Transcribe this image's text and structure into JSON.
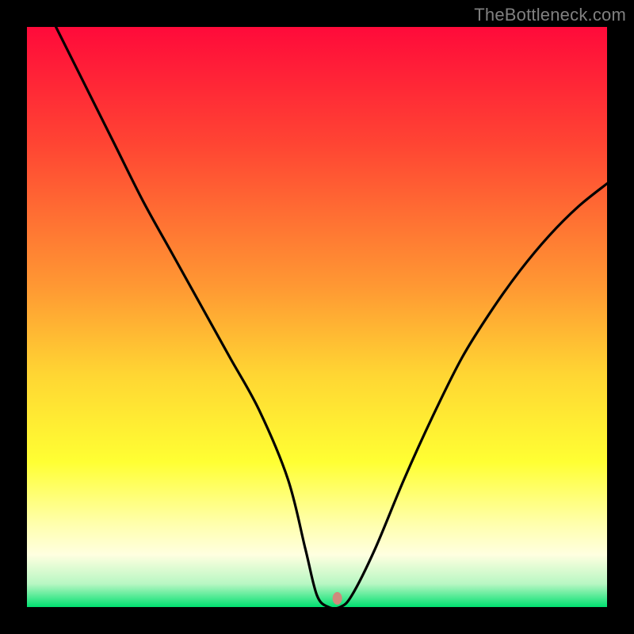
{
  "watermark": "TheBottleneck.com",
  "chart_data": {
    "type": "line",
    "title": "",
    "xlabel": "",
    "ylabel": "",
    "xlim": [
      0,
      100
    ],
    "ylim": [
      0,
      100
    ],
    "grid": false,
    "legend": false,
    "background_gradient_stops": [
      {
        "offset": 0.0,
        "color": "#ff0a3a"
      },
      {
        "offset": 0.2,
        "color": "#ff4433"
      },
      {
        "offset": 0.45,
        "color": "#ff9933"
      },
      {
        "offset": 0.6,
        "color": "#ffd633"
      },
      {
        "offset": 0.75,
        "color": "#ffff33"
      },
      {
        "offset": 0.86,
        "color": "#ffffb0"
      },
      {
        "offset": 0.91,
        "color": "#ffffe0"
      },
      {
        "offset": 0.96,
        "color": "#b8f7c3"
      },
      {
        "offset": 1.0,
        "color": "#00e070"
      }
    ],
    "series": [
      {
        "name": "bottleneck-curve",
        "x": [
          5,
          10,
          15,
          20,
          25,
          30,
          35,
          40,
          45,
          48,
          50,
          52,
          54,
          56,
          60,
          65,
          70,
          75,
          80,
          85,
          90,
          95,
          100
        ],
        "y": [
          100,
          90,
          80,
          70,
          61,
          52,
          43,
          34,
          22,
          10,
          2,
          0,
          0,
          2,
          10,
          22,
          33,
          43,
          51,
          58,
          64,
          69,
          73
        ]
      }
    ],
    "marker": {
      "name": "optimal-point",
      "x": 53.5,
      "y": 1.5,
      "color": "#cf8a7c",
      "rx": 6,
      "ry": 8
    }
  }
}
